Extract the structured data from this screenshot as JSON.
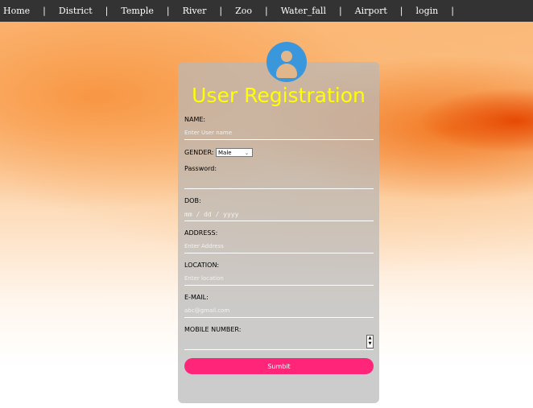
{
  "nav": {
    "items": [
      {
        "label": "Home"
      },
      {
        "label": "District"
      },
      {
        "label": "Temple"
      },
      {
        "label": "River"
      },
      {
        "label": "Zoo"
      },
      {
        "label": "Water_fall"
      },
      {
        "label": "Airport"
      },
      {
        "label": "login"
      }
    ],
    "separator": "|"
  },
  "form": {
    "title": "User Registration",
    "avatar_icon": "user-icon",
    "name": {
      "label": "NAME:",
      "placeholder": "Enter User name"
    },
    "gender": {
      "label": "GENDER:",
      "selected": "Male"
    },
    "password": {
      "label": "Password:"
    },
    "dob": {
      "label": "DOB:",
      "placeholder": "mm / dd / yyyy"
    },
    "address": {
      "label": "ADDRESS:",
      "placeholder": "Enter Address"
    },
    "location": {
      "label": "LOCATION:",
      "placeholder": "Enter location"
    },
    "email": {
      "label": "E-MAIL:",
      "placeholder": "abc@gmail.com"
    },
    "mobile": {
      "label": "MOBILE NUMBER:"
    },
    "submit_label": "Sumbit"
  },
  "colors": {
    "navbar": "#333333",
    "title": "#ffff00",
    "avatar": "#3b97dc",
    "submit": "#ff2679"
  }
}
